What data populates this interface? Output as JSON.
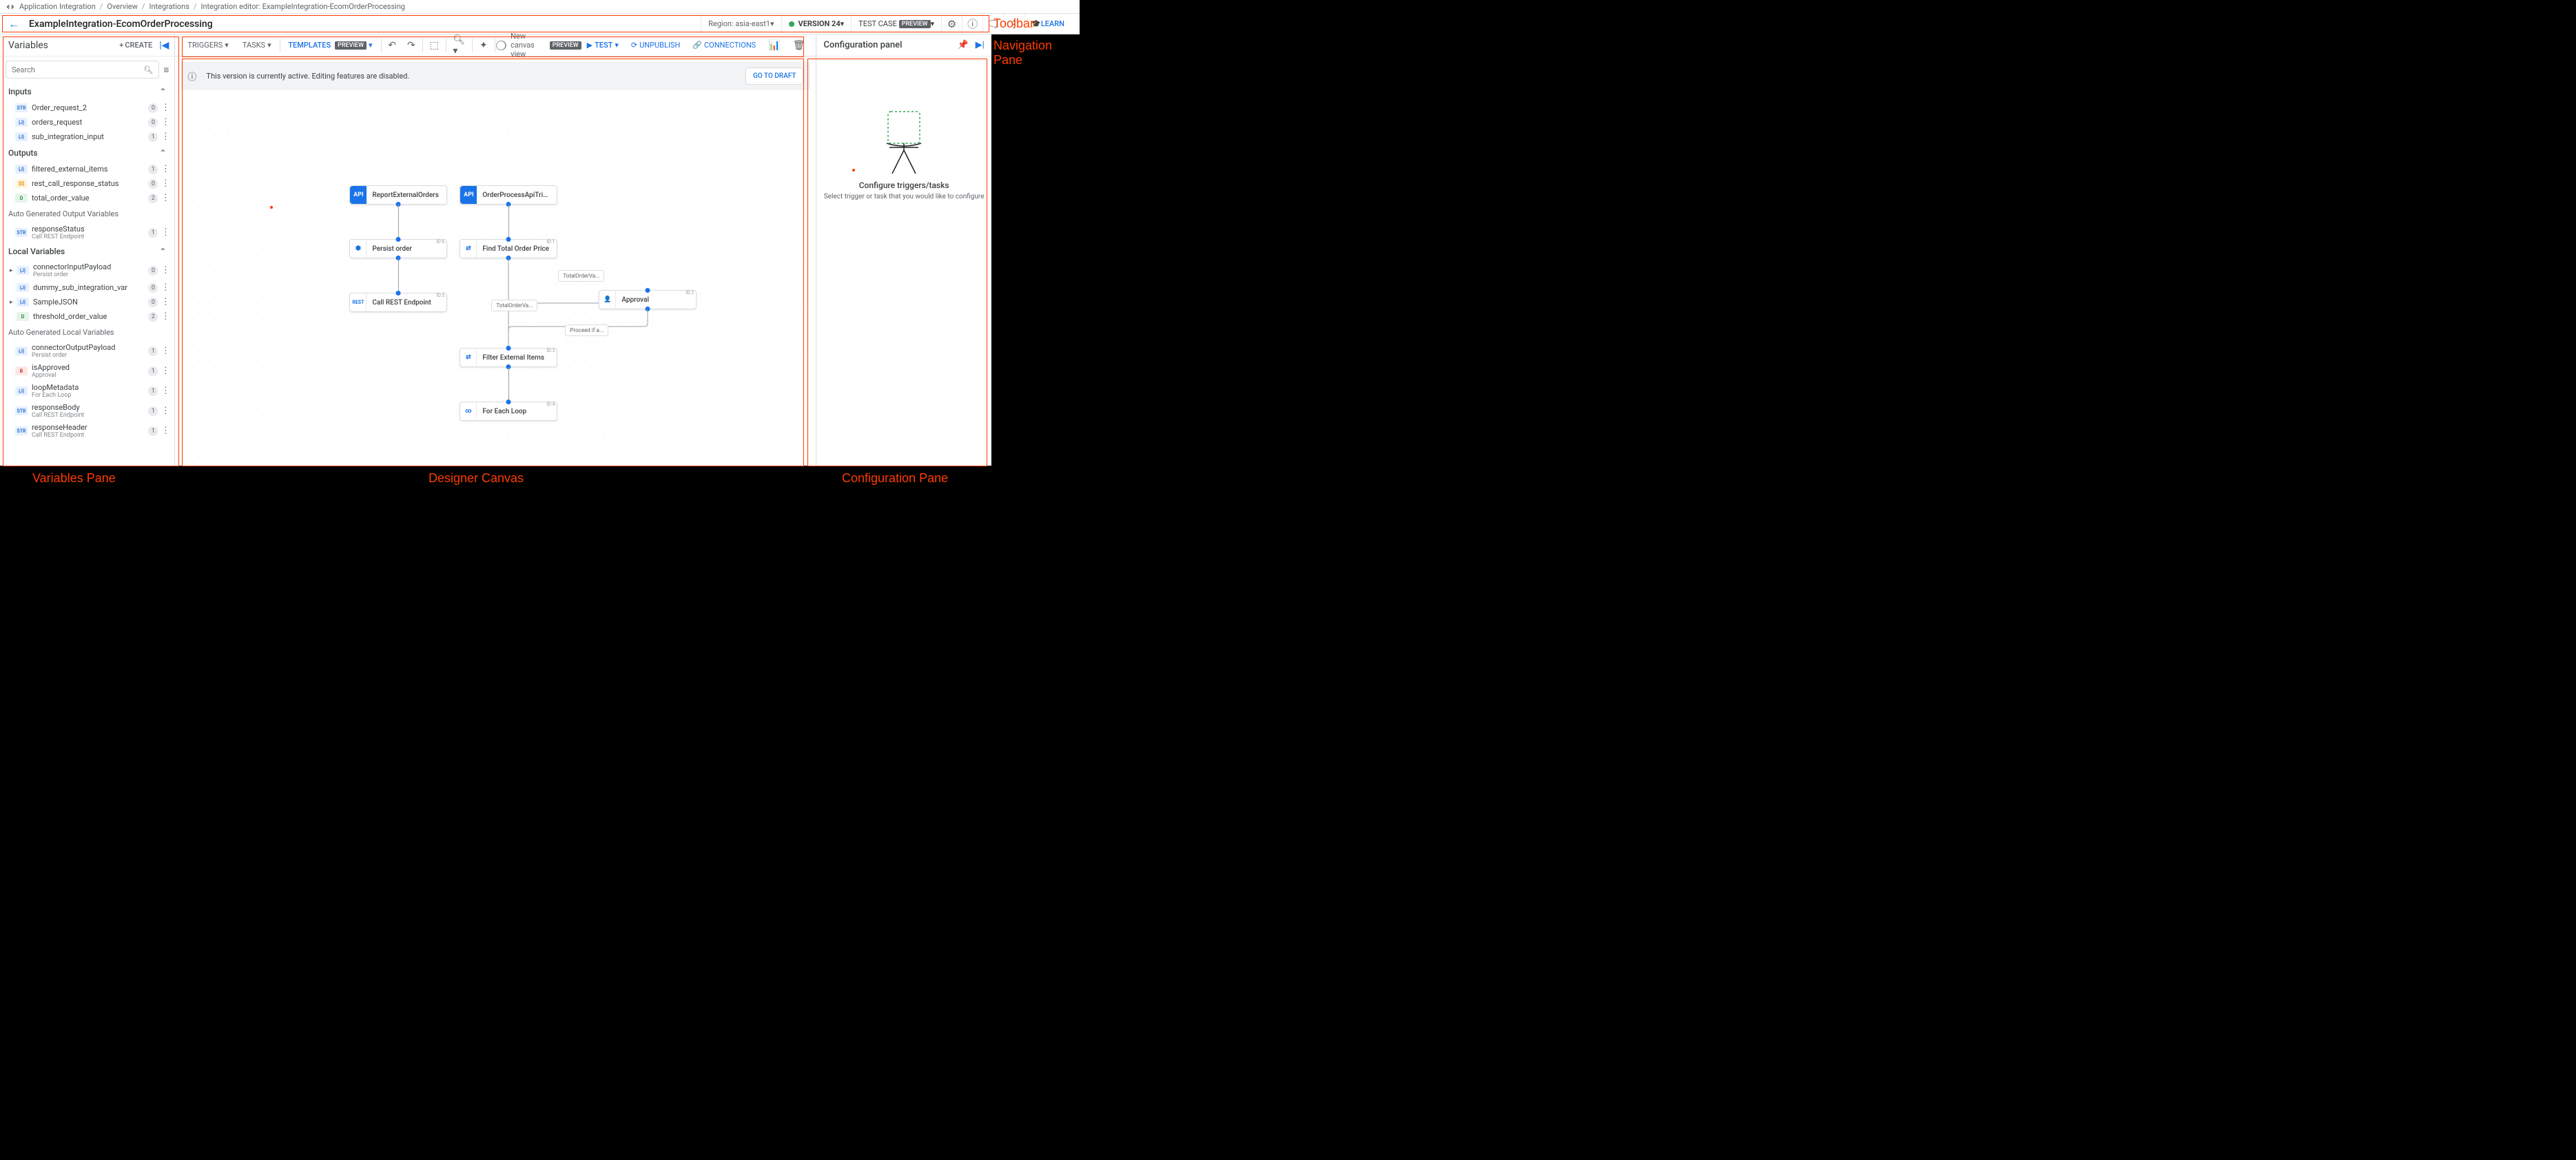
{
  "breadcrumb": {
    "app": "Application Integration",
    "items": [
      "Overview",
      "Integrations"
    ],
    "current": "Integration editor: ExampleIntegration-EcomOrderProcessing"
  },
  "header": {
    "title": "ExampleIntegration-EcomOrderProcessing",
    "region_label": "Region: asia-east1",
    "version": "VERSION 24",
    "test_case": "TEST CASE",
    "preview": "PREVIEW",
    "learn": "LEARN"
  },
  "annotations": {
    "toolbar": "Toolbar",
    "nav_pane": "Navigation Pane",
    "vars_pane": "Variables Pane",
    "designer_canvas": "Designer Canvas",
    "config_pane": "Configuration Pane"
  },
  "variables": {
    "title": "Variables",
    "create": "CREATE",
    "search_placeholder": "Search",
    "sections": {
      "inputs": "Inputs",
      "outputs": "Outputs",
      "auto_out": "Auto Generated Output Variables",
      "locals": "Local Variables",
      "auto_locals": "Auto Generated Local Variables"
    },
    "inputs": [
      {
        "type": "STR",
        "name": "Order_request_2",
        "count": "0"
      },
      {
        "type": "{J}",
        "name": "orders_request",
        "count": "0"
      },
      {
        "type": "{J}",
        "name": "sub_integration_input",
        "count": "1"
      }
    ],
    "outputs": [
      {
        "type": "{J}",
        "name": "filtered_external_items",
        "count": "1"
      },
      {
        "type": "[S]",
        "name": "rest_call_response_status",
        "count": "0"
      },
      {
        "type": "D",
        "name": "total_order_value",
        "count": "2"
      }
    ],
    "auto_out": [
      {
        "type": "STR",
        "name": "responseStatus",
        "sub": "Call REST Endpoint",
        "count": "1"
      }
    ],
    "locals": [
      {
        "type": "{J}",
        "name": "connectorInputPayload",
        "sub": "Persist order",
        "count": "0",
        "expandable": true
      },
      {
        "type": "{J}",
        "name": "dummy_sub_integration_var",
        "count": "0"
      },
      {
        "type": "{J}",
        "name": "SampleJSON",
        "count": "0",
        "expandable": true
      },
      {
        "type": "D",
        "name": "threshold_order_value",
        "count": "2"
      }
    ],
    "auto_locals": [
      {
        "type": "{J}",
        "name": "connectorOutputPayload",
        "sub": "Persist order",
        "count": "1"
      },
      {
        "type": "B",
        "name": "isApproved",
        "sub": "Approval",
        "count": "1"
      },
      {
        "type": "{J}",
        "name": "loopMetadata",
        "sub": "For Each Loop",
        "count": "1"
      },
      {
        "type": "STR",
        "name": "responseBody",
        "sub": "Call REST Endpoint",
        "count": "1"
      },
      {
        "type": "STR",
        "name": "responseHeader",
        "sub": "Call REST Endpoint",
        "count": "1"
      }
    ]
  },
  "canvas_toolbar": {
    "triggers": "TRIGGERS",
    "tasks": "TASKS",
    "templates": "TEMPLATES",
    "preview": "PREVIEW",
    "new_canvas": "New canvas view",
    "test": "TEST",
    "unpublish": "UNPUBLISH",
    "connections": "CONNECTIONS"
  },
  "banner": {
    "text": "This version is currently active. Editing features are disabled.",
    "go_draft": "GO TO DRAFT"
  },
  "nodes": {
    "report_ext": "ReportExternalOrders",
    "order_trigger": "OrderProcessApiTrigger",
    "persist": "Persist order",
    "persist_id": "ID:6",
    "find_total": "Find Total Order Price",
    "find_total_id": "ID:1",
    "call_rest": "Call REST Endpoint",
    "call_rest_id": "ID:5",
    "approval": "Approval",
    "approval_id": "ID:2",
    "filter_ext": "Filter External Items",
    "filter_ext_id": "ID:3",
    "for_each": "For Each Loop",
    "for_each_id": "ID:4",
    "edge_total1": "TotalOrderVa...",
    "edge_total2": "TotalOrderVa...",
    "edge_proceed": "Proceed if a..."
  },
  "config": {
    "title": "Configuration panel",
    "empty_title": "Configure triggers/tasks",
    "empty_sub": "Select trigger or task that you would like to configure"
  }
}
